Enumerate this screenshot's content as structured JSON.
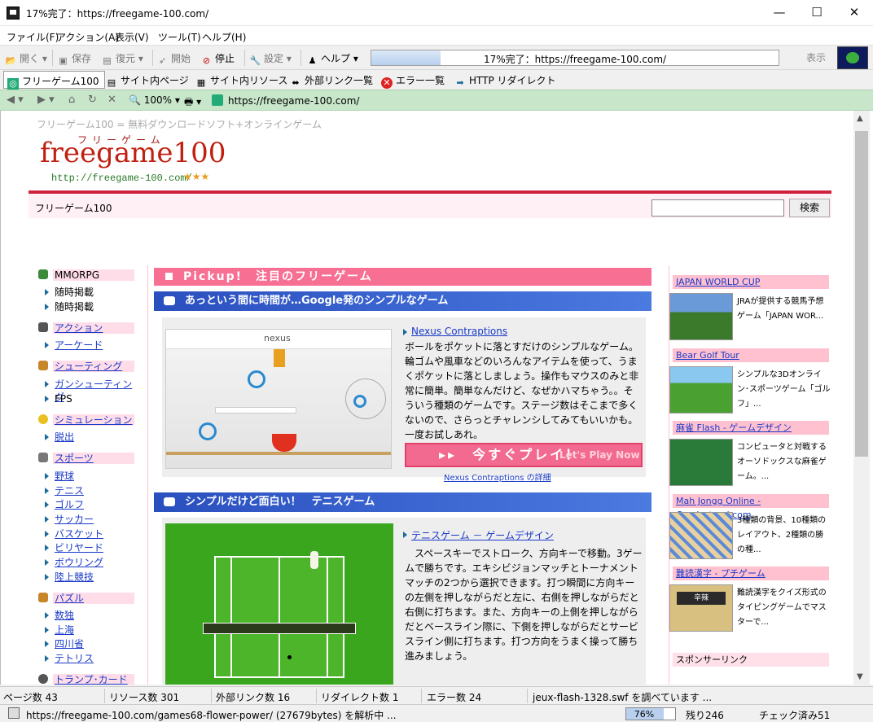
{
  "window": {
    "title": "17%完了：https://freegame-100.com/"
  },
  "menu": [
    "ファイル(F)",
    "アクション(A)",
    "表示(V)",
    "ツール(T)",
    "ヘルプ(H)"
  ],
  "toolbar": {
    "open": "開く",
    "save": "保存",
    "restore": "復元",
    "start": "開始",
    "stop": "停止",
    "settings": "設定",
    "help": "ヘルプ",
    "progress_text": "17%完了：https://freegame-100.com/",
    "progress": 0.17,
    "display": "表示"
  },
  "tabs": [
    "フリーゲーム100",
    "サイト内ページ",
    "サイト内リソース",
    "外部リンク一覧",
    "エラー一覧",
    "HTTP リダイレクト"
  ],
  "nav": {
    "zoom": "100%",
    "url": "https://freegame-100.com/"
  },
  "page": {
    "tagline": "フリーゲーム100 = 無料ダウンロードソフト+オンラインゲーム",
    "brand_jp": "フリーゲーム",
    "brand": "freegame100",
    "brand_url": "http://freegame-100.com/",
    "stars": "★★★",
    "crumb": "フリーゲーム100",
    "search_button": "検索",
    "left_nav": {
      "mmorpg": "MMORPG",
      "mmorpg_sub": [
        "随時掲載",
        "随時掲載"
      ],
      "action": "アクション",
      "action_sub": [
        "アーケード"
      ],
      "shooting": "シューティング",
      "shooting_sub": [
        "ガンシューティング",
        "FPS"
      ],
      "simulation": "シミュレーション",
      "simulation_sub": [
        "脱出"
      ],
      "sports": "スポーツ",
      "sports_sub": [
        "野球",
        "テニス",
        "ゴルフ",
        "サッカー",
        "バスケット",
        "ビリヤード",
        "ボウリング",
        "陸上競技"
      ],
      "puzzle": "パズル",
      "puzzle_sub": [
        "数独",
        "上海",
        "四川省",
        "テトリス"
      ],
      "cards": "トランプ･カード"
    },
    "pickup": "Pickup!　注目のフリーゲーム",
    "section1": "あっという間に時間が…Google発のシンプルなゲーム",
    "game1": {
      "title": "Nexus Contraptions",
      "desc": "ボールをポケットに落とすだけのシンプルなゲーム。輪ゴムや風車などのいろんなアイテムを使って、うまくポケットに落としましょう。操作もマウスのみと非常に簡単。簡単なんだけど、なぜかハマちゃう。。そういう種類のゲームです。ステージ数はそこまで多くないので、さらっとチャレンシしてみてもいいかも。一度お試しあれ。",
      "play": "▸▸　今すぐプレイ！",
      "play_ghost": "Let's Play Now",
      "detail": "Nexus Contraptions の詳細",
      "nexus": "nexus"
    },
    "section2": "シンプルだけど面白い！　テニスゲーム",
    "game2": {
      "title": "テニスゲーム － ゲームデザイン",
      "desc": "スペースキーでストローク、方向キーで移動。3ゲームで勝ちです。エキシビジョンマッチとトーナメントマッチの2つから選択できます。打つ瞬間に方向キーの左側を押しながらだと左に、右側を押しながらだと右側に打ちます。また、方向キーの上側を押しながらだとベースライン際に、下側を押しながらだとサービスライン側に打ちます。打つ方向をうまく操って勝ち進みましょう。"
    },
    "right": [
      {
        "title": "JAPAN WORLD CUP",
        "desc": "JRAが提供する競馬予想ゲーム「JAPAN WOR..."
      },
      {
        "title": "Bear Golf Tour",
        "desc": "シンプルな3Dオンライン･スポーツゲーム「ゴルフ」..."
      },
      {
        "title": "麻雀 Flash - ゲームデザイン",
        "desc": "コンピュータと対戦するオーソドックスな麻雀ゲーム。..."
      },
      {
        "title": "Mah Jongg Online - Candystand.com",
        "desc": "3種類の背景、10種類のレイアウト、2種類の勝の種..."
      },
      {
        "title": "難読漢字 - プチゲーム",
        "desc": "難読漢字をクイズ形式のタイピングゲームでマスターで..."
      }
    ],
    "sponsor": "スポンサーリンク",
    "kanji_quiz": "辛辣"
  },
  "status": {
    "pages": "ページ数 43",
    "resources": "リソース数 301",
    "external": "外部リンク数 16",
    "redirects": "リダイレクト数 1",
    "errors": "エラー数 24",
    "current": "jeux-flash-1328.swf を調べています ...",
    "parsing": "https://freegame-100.com/games68-flower-power/ (27679bytes) を解析中 ...",
    "percent": "76%",
    "progress": 0.76,
    "remaining": "残り246",
    "checked": "チェック済み51"
  },
  "colors": {
    "accent_pink": "#f76f93",
    "section_blue": "#3a63cf",
    "nav_green": "#c8e6c9",
    "link_blue": "#1a3ac8",
    "brand_red": "#c02010"
  }
}
